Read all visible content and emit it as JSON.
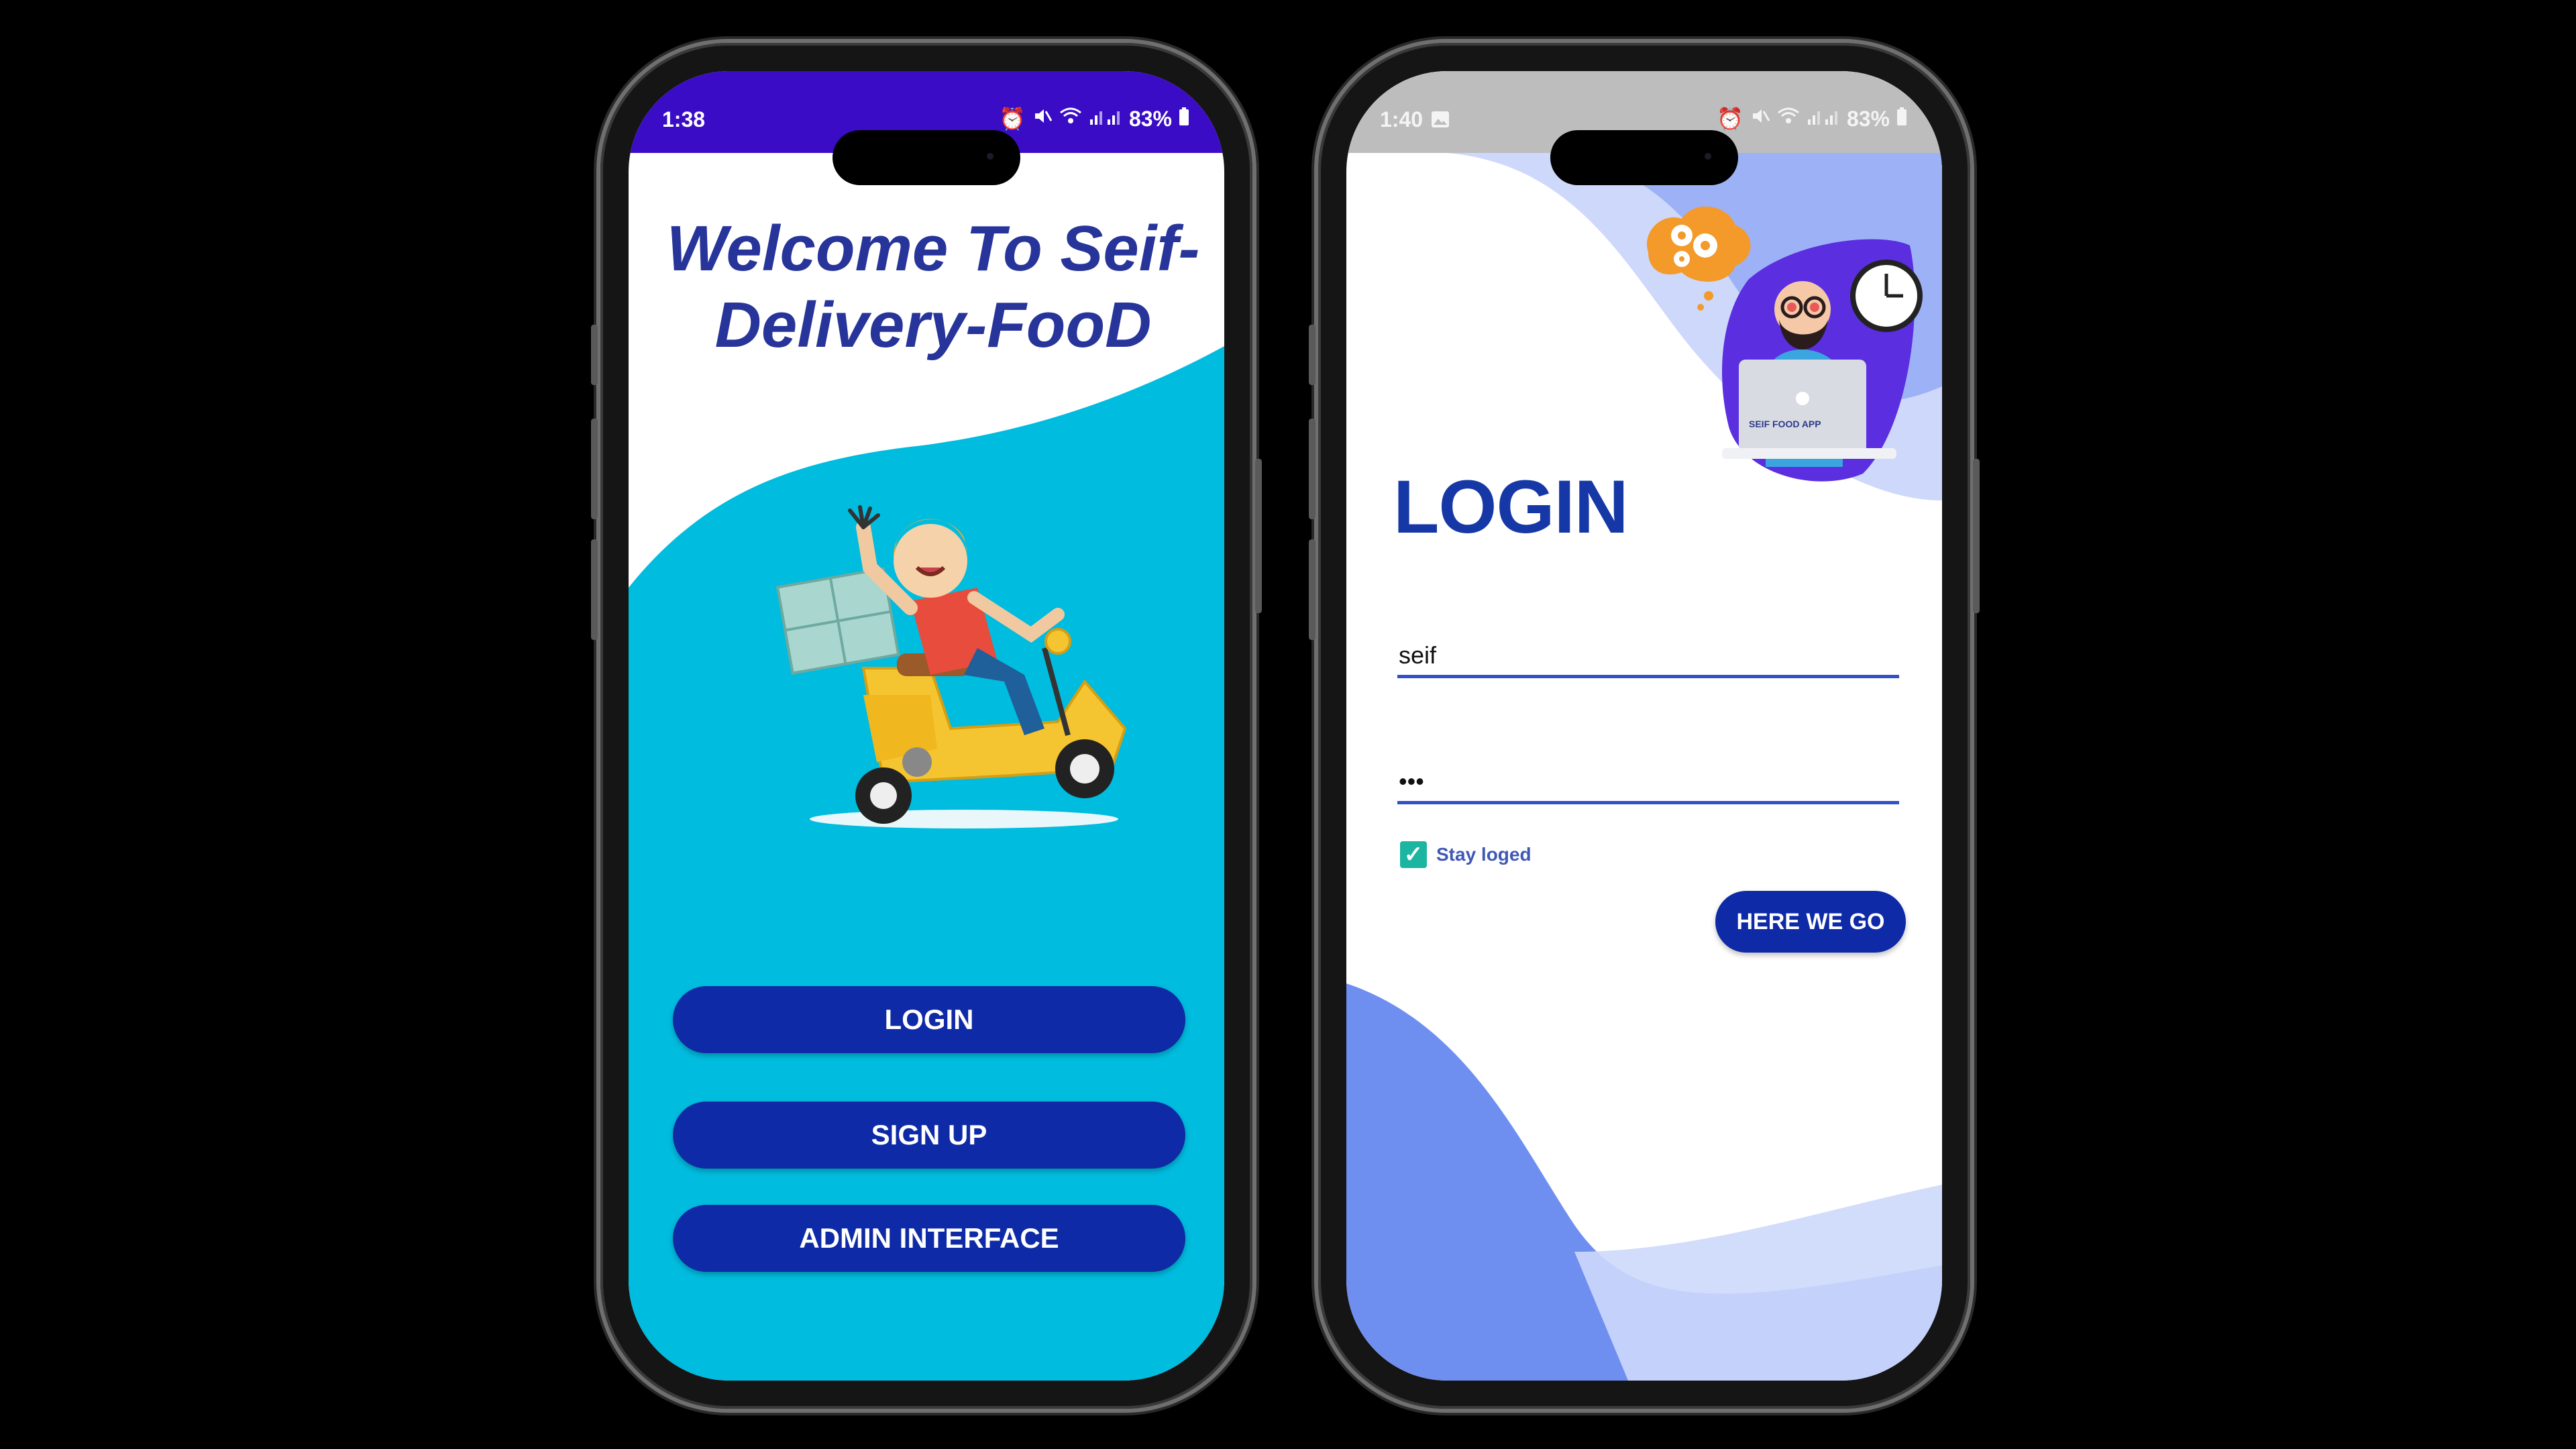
{
  "left_phone": {
    "status": {
      "time": "1:38",
      "battery": "83%"
    },
    "welcome_title": "Welcome To Seif-Delivery-FooD",
    "buttons": {
      "login": "LOGIN",
      "signup": "SIGN UP",
      "admin": "ADMIN INTERFACE"
    },
    "colors": {
      "accent": "#0e2aa6",
      "wave": "#00bcdf",
      "title": "#27349a",
      "statusbar": "#3a0cc5"
    }
  },
  "right_phone": {
    "status": {
      "time": "1:40",
      "battery": "83%"
    },
    "title": "LOGIN",
    "illustration_label": "SEIF FOOD APP",
    "username_value": "seif",
    "password_value": "•••",
    "stay_logged_label": "Stay loged",
    "stay_logged_checked": true,
    "submit_label": "HERE WE GO",
    "colors": {
      "accent": "#0e2aa6",
      "wave": "#6f8ff0",
      "checkbox": "#1bb5a2"
    }
  }
}
